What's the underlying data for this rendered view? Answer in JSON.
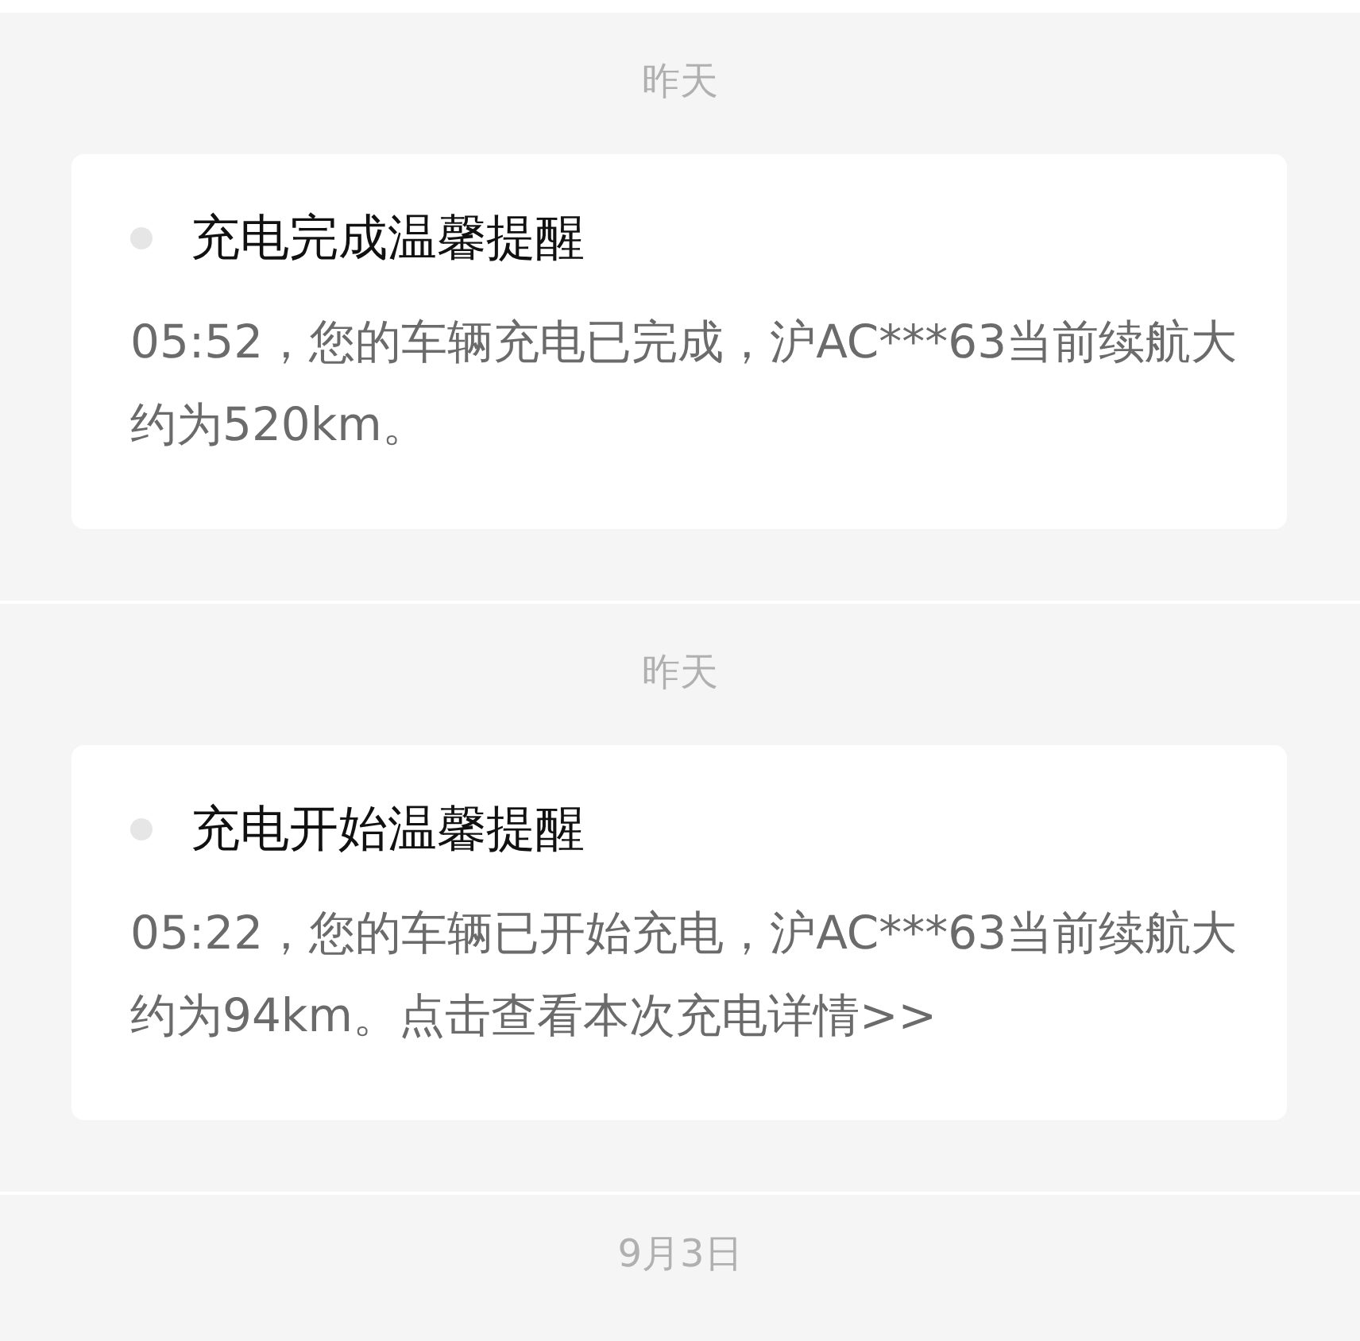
{
  "messages": [
    {
      "date": "昨天",
      "title": "充电完成温馨提醒",
      "body": "05:52，您的车辆充电已完成，沪AC***63当前续航大约为520km。"
    },
    {
      "date": "昨天",
      "title": "充电开始温馨提醒",
      "body": "05:22，您的车辆已开始充电，沪AC***63当前续航大约为94km。点击查看本次充电详情>>"
    }
  ],
  "next_date": "9月3日"
}
